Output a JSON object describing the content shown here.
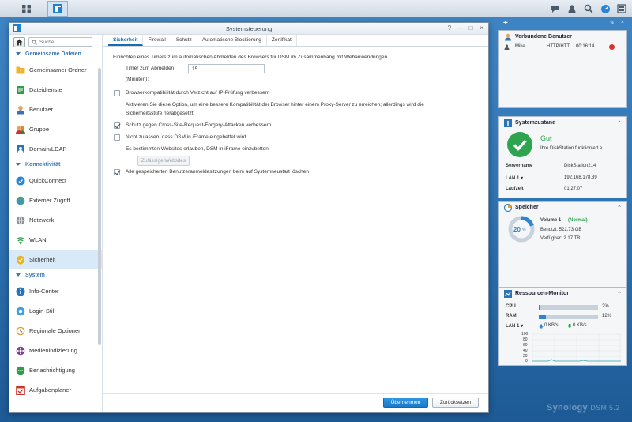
{
  "window": {
    "title": "Systemsteuerung",
    "controls": [
      "?",
      "–",
      "□",
      "×"
    ]
  },
  "search": {
    "placeholder": "Suche"
  },
  "sidebar": {
    "sections": [
      {
        "label": "Gemeinsame Dateien",
        "items": [
          "Gemeinsamer Ordner",
          "Dateidienste",
          "Benutzer",
          "Gruppe",
          "Domain/LDAP"
        ]
      },
      {
        "label": "Konnektivität",
        "items": [
          "QuickConnect",
          "Externer Zugriff",
          "Netzwerk",
          "WLAN",
          "Sicherheit"
        ]
      },
      {
        "label": "System",
        "items": [
          "Info-Center",
          "Login-Stil",
          "Regionale Optionen",
          "Medienindizierung",
          "Benachrichtigung",
          "Aufgabenplaner"
        ]
      }
    ],
    "selected": "Sicherheit"
  },
  "tabs": [
    "Sicherheit",
    "Firewall",
    "Schutz",
    "Automatische Blockierung",
    "Zertifikat"
  ],
  "settings": {
    "intro": "Einrichten eines Timers zum automatischen Abmelden des Browsers für DSM im Zusammenhang mit Webanwendungen.",
    "timer_label": "Timer zum Abmelden",
    "timer_unit": "(Minuten):",
    "timer_value": "15",
    "cb1_label": "Browserkompatibilität durch Verzicht auf IP-Prüfung verbessern",
    "cb1_checked": false,
    "cb1_desc1": "Aktivieren Sie diese Option, um eine bessere Kompatibilität der Browser hinter einem Proxy-Server zu erreichen; allerdings wird die",
    "cb1_desc2": "Sicherheitsstufe herabgesetzt.",
    "cb2_label": "Schutz gegen Cross-Site-Request-Forgery-Attacken verbessern",
    "cb2_checked": true,
    "cb3_label": "Nicht zulassen, dass DSM in iFrame eingebettet wird",
    "cb3_checked": false,
    "cb3_desc": "Es bestimmten Websites erlauben, DSM in iFrame einzubetten",
    "allowed_sites_button": "Zulässige Websites",
    "cb4_label": "Alle gespeicherten Benutzeranmeldesitzungen beim auf Systemneustart löschen",
    "cb4_checked": true
  },
  "footer": {
    "apply": "Übernehmen",
    "reset": "Zurücksetzen"
  },
  "widgets": {
    "users": {
      "title": "Verbundene Benutzer",
      "rows": [
        {
          "name": "Mike",
          "type": "HTTP/HTT...",
          "time": "00:16:14"
        }
      ]
    },
    "status": {
      "title": "Systemzustand",
      "state": "Gut",
      "message": "Ihre DiskStation funktioniert e...",
      "servername_label": "Servername",
      "servername": "DiskStation214",
      "lan_label": "LAN 1 ▾",
      "lan_ip": "192.168.178.39",
      "uptime_label": "Laufzeit",
      "uptime": "01:27:07"
    },
    "storage": {
      "title": "Speicher",
      "percent": "20",
      "percent_unit": "%",
      "volume_name": "Volume 1",
      "volume_status": "(Normal)",
      "used": "Benutzt: 522.73 GB",
      "free": "Verfügbar: 2.17 TB"
    },
    "resource": {
      "title": "Ressourcen-Monitor",
      "cpu_label": "CPU",
      "cpu_value": "2%",
      "cpu_fraction": 0.02,
      "ram_label": "RAM",
      "ram_value": "12%",
      "ram_fraction": 0.12,
      "lan_label": "LAN 1 ▾",
      "up": "0 KB/s",
      "down": "0 KB/s",
      "chart_ticks": [
        "100",
        "80",
        "60",
        "40",
        "20",
        "0"
      ]
    }
  },
  "brand": {
    "name": "Synology",
    "version": "DSM 5.2"
  },
  "colors": {
    "accent": "#1b6bb3",
    "ok": "#2ea44f",
    "error": "#d9342b"
  }
}
